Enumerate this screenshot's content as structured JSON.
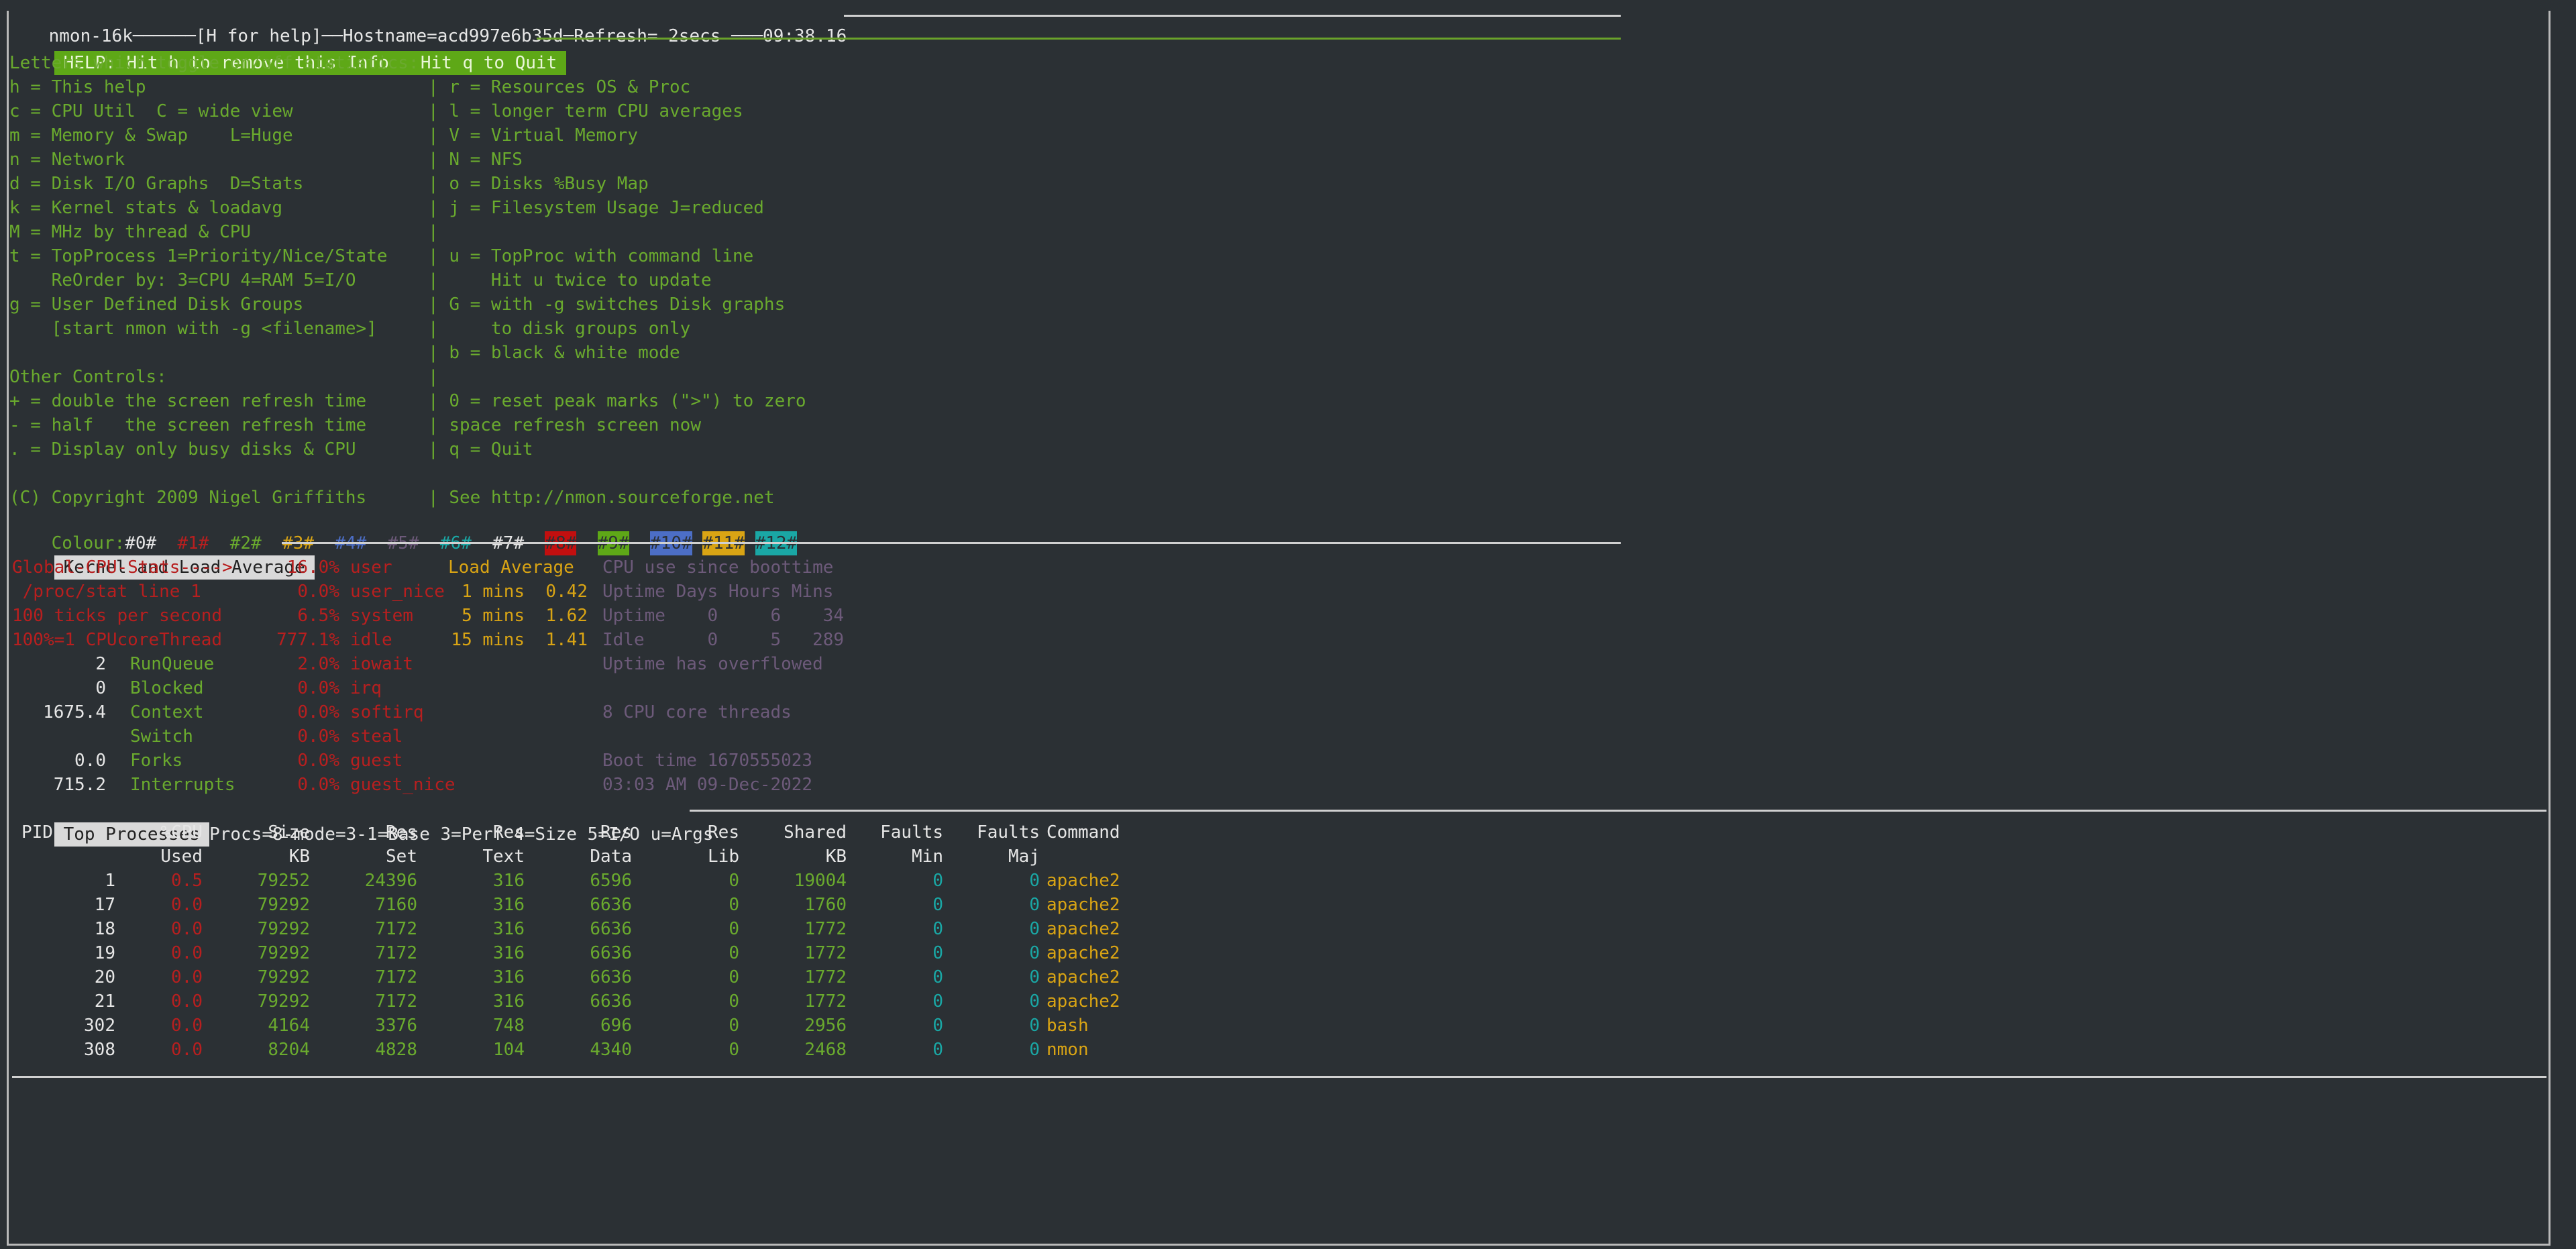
{
  "title_bar": "nmon-16k──────[H for help]──Hostname=acd997e6b35d─Refresh= 2secs ───09:38.16",
  "help": {
    "header": "HELP: Hit h to remove this Info   Hit q to Quit",
    "intro": "Letters which toggle on/off statistics:",
    "left": [
      "h = This help",
      "c = CPU Util  C = wide view",
      "m = Memory & Swap    L=Huge",
      "n = Network",
      "d = Disk I/O Graphs  D=Stats",
      "k = Kernel stats & loadavg",
      "M = MHz by thread & CPU",
      "t = TopProcess 1=Priority/Nice/State",
      "    ReOrder by: 3=CPU 4=RAM 5=I/O",
      "g = User Defined Disk Groups",
      "    [start nmon with -g <filename>]",
      "",
      "Other Controls:",
      "+ = double the screen refresh time",
      "- = half   the screen refresh time",
      ". = Display only busy disks & CPU",
      "",
      "(C) Copyright 2009 Nigel Griffiths"
    ],
    "right": [
      "r = Resources OS & Proc",
      "l = longer term CPU averages",
      "V = Virtual Memory",
      "N = NFS",
      "o = Disks %Busy Map",
      "j = Filesystem Usage J=reduced",
      "",
      "u = TopProc with command line",
      "    Hit u twice to update",
      "G = with -g switches Disk graphs",
      "    to disk groups only",
      "b = black & white mode",
      "",
      "0 = reset peak marks (\">\") to zero",
      "space refresh screen now",
      "q = Quit",
      "",
      "See http://nmon.sourceforge.net"
    ],
    "colour_label": "Colour:",
    "colours": [
      "#0#",
      "#1#",
      "#2#",
      "#3#",
      "#4#",
      "#5#",
      "#6#",
      "#7#",
      "#8#",
      "#9#",
      "#10#",
      "#11#",
      "#12#"
    ]
  },
  "kernel": {
    "header": "Kernel and Load Average",
    "col1": [
      "Global-CPU-Stats---->",
      " /proc/stat line 1",
      "100 ticks per second",
      "100%=1 CPUcoreThread"
    ],
    "cpu": [
      {
        "value": "16.0%",
        "label": "user"
      },
      {
        "value": "0.0%",
        "label": "user_nice"
      },
      {
        "value": "6.5%",
        "label": "system"
      },
      {
        "value": "777.1%",
        "label": "idle"
      },
      {
        "value": "2.0%",
        "label": "iowait"
      },
      {
        "value": "0.0%",
        "label": "irq"
      },
      {
        "value": "0.0%",
        "label": "softirq"
      },
      {
        "value": "0.0%",
        "label": "steal"
      },
      {
        "value": "0.0%",
        "label": "guest"
      },
      {
        "value": "0.0%",
        "label": "guest_nice"
      }
    ],
    "counters": [
      {
        "value": "2",
        "label": "RunQueue"
      },
      {
        "value": "0",
        "label": "Blocked"
      },
      {
        "value": "1675.4",
        "label": "Context"
      },
      {
        "value": "",
        "label": "Switch"
      },
      {
        "value": "0.0",
        "label": "Forks"
      },
      {
        "value": "715.2",
        "label": "Interrupts"
      }
    ],
    "load_title": "Load Average",
    "load": [
      {
        "period": "1 mins",
        "value": "0.42"
      },
      {
        "period": "5 mins",
        "value": "1.62"
      },
      {
        "period": "15 mins",
        "value": "1.41"
      }
    ],
    "boot": [
      "CPU use since boottime",
      "Uptime Days Hours Mins",
      "Uptime    0     6    34",
      "Idle      0     5   289",
      "Uptime has overflowed",
      "",
      "8 CPU core threads",
      "",
      "Boot time 1670555023",
      "03:03 AM 09-Dec-2022"
    ]
  },
  "top": {
    "header": "Top Processes",
    "options": "Procs=8-mode=3-1=Base 3=Perf 4=Size 5=I/O u=Args",
    "col_headers": [
      [
        "PID",
        ""
      ],
      [
        "%CPU",
        "Used"
      ],
      [
        "Size",
        "KB"
      ],
      [
        "Res",
        "Set"
      ],
      [
        "Res",
        "Text"
      ],
      [
        "Res",
        "Data"
      ],
      [
        "Res",
        "Lib"
      ],
      [
        "Shared",
        "KB"
      ],
      [
        "Faults",
        "Min"
      ],
      [
        "Faults",
        "Maj"
      ],
      [
        "Command",
        ""
      ]
    ],
    "rows": [
      [
        "1",
        "0.5",
        "79252",
        "24396",
        "316",
        "6596",
        "0",
        "19004",
        "0",
        "0",
        "apache2"
      ],
      [
        "17",
        "0.0",
        "79292",
        "7160",
        "316",
        "6636",
        "0",
        "1760",
        "0",
        "0",
        "apache2"
      ],
      [
        "18",
        "0.0",
        "79292",
        "7172",
        "316",
        "6636",
        "0",
        "1772",
        "0",
        "0",
        "apache2"
      ],
      [
        "19",
        "0.0",
        "79292",
        "7172",
        "316",
        "6636",
        "0",
        "1772",
        "0",
        "0",
        "apache2"
      ],
      [
        "20",
        "0.0",
        "79292",
        "7172",
        "316",
        "6636",
        "0",
        "1772",
        "0",
        "0",
        "apache2"
      ],
      [
        "21",
        "0.0",
        "79292",
        "7172",
        "316",
        "6636",
        "0",
        "1772",
        "0",
        "0",
        "apache2"
      ],
      [
        "302",
        "0.0",
        "4164",
        "3376",
        "748",
        "696",
        "0",
        "2956",
        "0",
        "0",
        "bash"
      ],
      [
        "308",
        "0.0",
        "8204",
        "4828",
        "104",
        "4340",
        "0",
        "2468",
        "0",
        "0",
        "nmon"
      ]
    ]
  }
}
